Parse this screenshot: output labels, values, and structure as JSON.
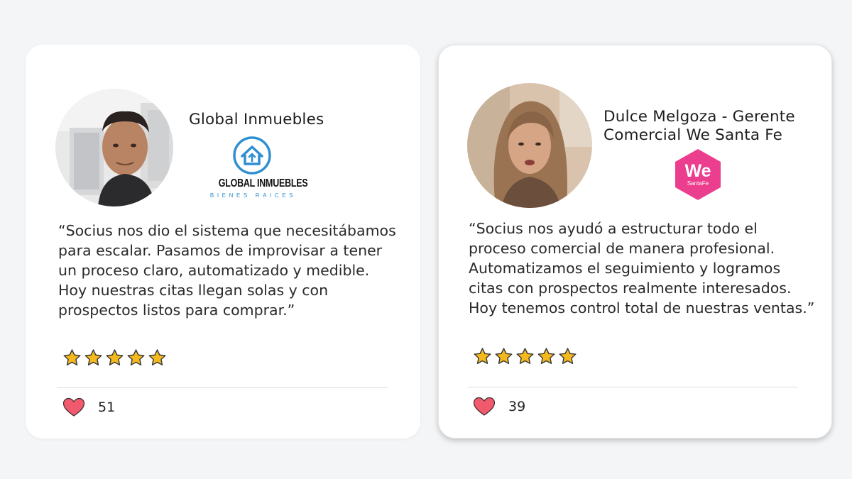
{
  "colors": {
    "background": "#f4f5f7",
    "card": "#ffffff",
    "star": "#f5b91e",
    "heart": "#f15a6c",
    "global_logo_blue": "#2f8fd0",
    "we_logo_pink": "#ec3e8f"
  },
  "testimonials": [
    {
      "name": "Global Inmuebles",
      "avatar_icon": "man-portrait-photo",
      "logo": {
        "icon": "house-circle-logo",
        "line1": "GLOBAL INMUEBLES",
        "line2": "BIENES RAICES"
      },
      "quote": "“Socius nos dio el sistema que necesitábamos para escalar. Pasamos de improvisar a tener un proceso claro, automatizado y medible. Hoy nuestras citas llegan solas y con prospectos listos para comprar.”",
      "rating": 5,
      "likes": "51"
    },
    {
      "name": "Dulce Melgoza - Gerente Comercial We Santa Fe",
      "avatar_icon": "woman-portrait-photo",
      "logo": {
        "icon": "we-hexagon-logo",
        "line1": "We",
        "line2": "SantaFe"
      },
      "quote": "“Socius nos ayudó a estructurar todo el proceso comercial de manera profesional. Automatizamos el seguimiento y logramos citas con prospectos realmente interesados. Hoy tenemos control total de nuestras ventas.”",
      "rating": 5,
      "likes": "39"
    }
  ]
}
